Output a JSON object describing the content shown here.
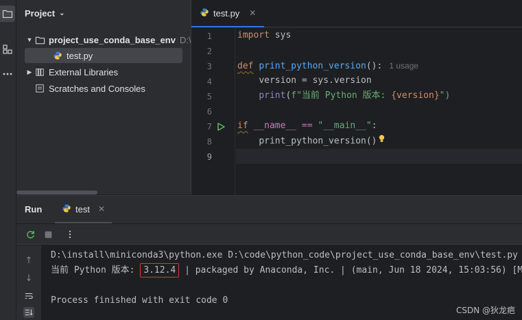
{
  "project_panel": {
    "title": "Project",
    "tree": [
      {
        "label": "project_use_conda_base_env",
        "hint": "D:\\co"
      },
      {
        "label": "test.py"
      },
      {
        "label": "External Libraries"
      },
      {
        "label": "Scratches and Consoles"
      }
    ]
  },
  "editor": {
    "tab_label": "test.py",
    "line_numbers": [
      "1",
      "2",
      "3",
      "4",
      "5",
      "6",
      "7",
      "8",
      "9"
    ],
    "usage_hint": "1 usage",
    "code": {
      "l1_kw": "import",
      "l1_rest": " sys",
      "l3_kw": "def",
      "l3_fn": "print_python_version",
      "l3_rest": "():",
      "l4_var": "version",
      "l4_rest": " = sys.version",
      "l5_bi": "print",
      "l5_open": "(",
      "l5_str": "f\"当前 Python 版本: ",
      "l5_brace": "{version}",
      "l5_end": "\")",
      "l7_kw": "if",
      "l7_name": " __name__ == ",
      "l7_str": "\"__main__\"",
      "l7_colon": ":",
      "l8_call": "print_python_version()"
    }
  },
  "run_panel": {
    "title": "Run",
    "tab_label": "test",
    "console": {
      "line1": "D:\\install\\miniconda3\\python.exe D:\\code\\python_code\\project_use_conda_base_env\\test.py",
      "line2_prefix": "当前 Python 版本: ",
      "line2_version": "3.12.4",
      "line2_suffix": " | packaged by Anaconda, Inc. | (main, Jun 18 2024, 15:03:56) [M",
      "line3": "Process finished with exit code 0"
    }
  },
  "watermark": "CSDN @狄龙疤",
  "colors": {
    "accent": "#3574f0",
    "highlight_box": "#d63b3b",
    "run_green": "#5fb865"
  }
}
